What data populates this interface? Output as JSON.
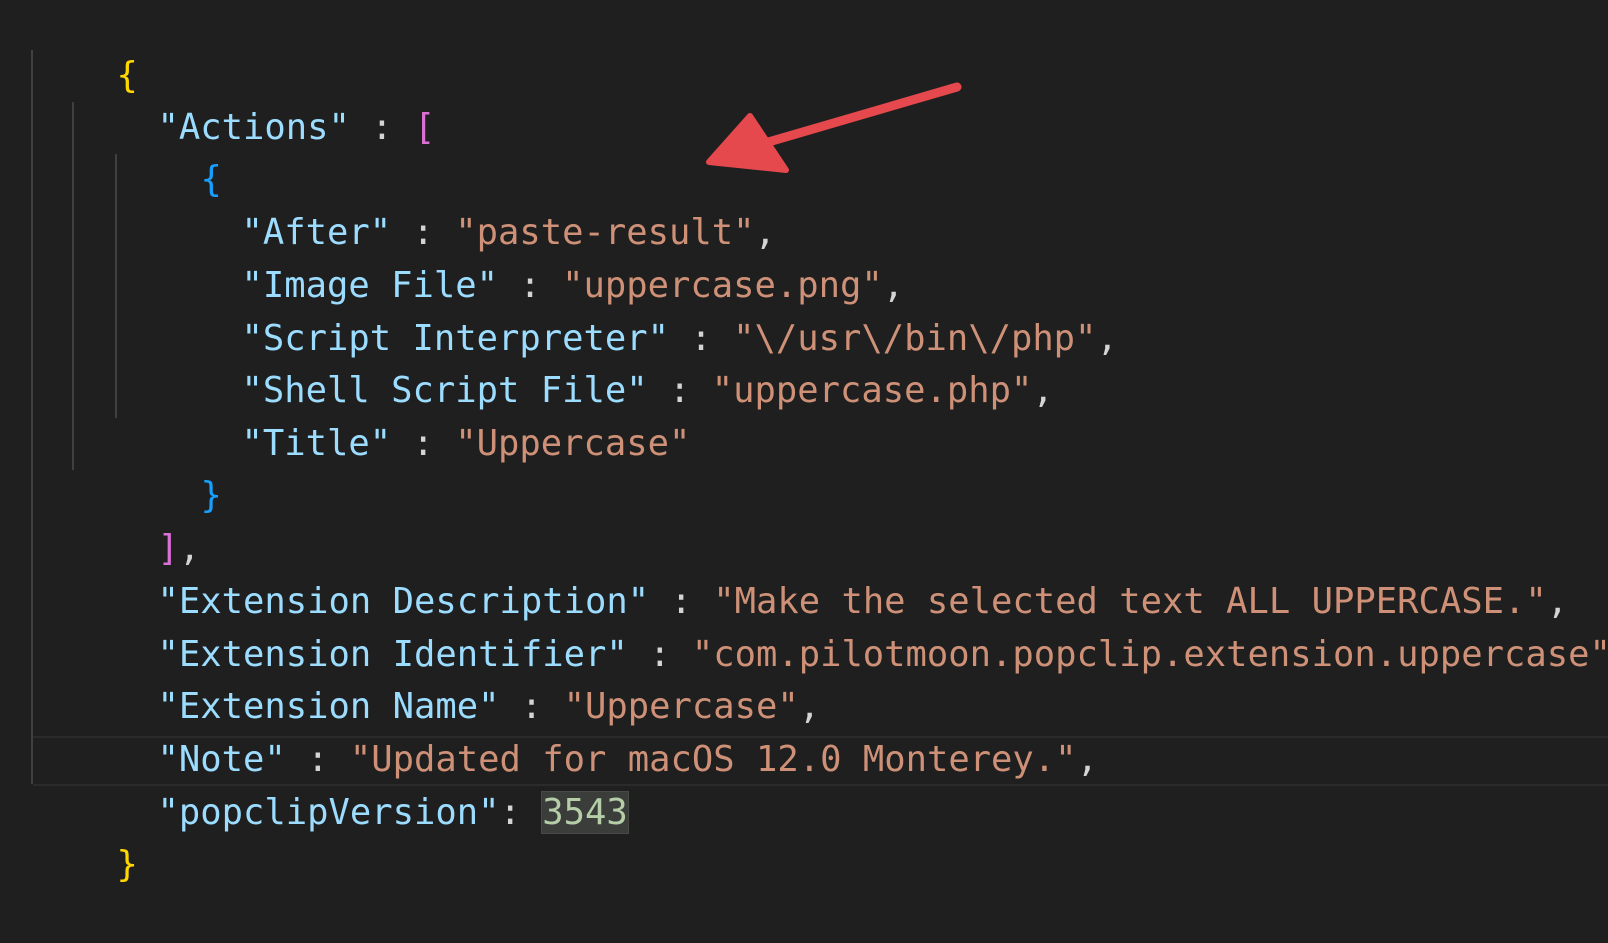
{
  "code": {
    "open_root": "{",
    "actions_key": "\"Actions\"",
    "colon": " : ",
    "open_array": "[",
    "open_obj": "{",
    "after_key": "\"After\"",
    "after_val": "\"paste-result\"",
    "image_key": "\"Image File\"",
    "image_val": "\"uppercase.png\"",
    "interp_key": "\"Script Interpreter\"",
    "interp_val": "\"\\/usr\\/bin\\/php\"",
    "shell_key": "\"Shell Script File\"",
    "shell_val": "\"uppercase.php\"",
    "title_key": "\"Title\"",
    "title_val": "\"Uppercase\"",
    "close_obj": "}",
    "close_array": "]",
    "comma": ",",
    "desc_key": "\"Extension Description\"",
    "desc_val": "\"Make the selected text ALL UPPERCASE.\"",
    "ident_key": "\"Extension Identifier\"",
    "ident_val": "\"com.pilotmoon.popclip.extension.uppercase\"",
    "name_key": "\"Extension Name\"",
    "name_val": "\"Uppercase\"",
    "note_key": "\"Note\"",
    "note_val": "\"Updated for macOS 12.0 Monterey.\"",
    "version_key": "\"popclipVersion\"",
    "version_colon": ": ",
    "version_val": "3543",
    "close_root": "}"
  },
  "colors": {
    "background": "#1f1f1f",
    "key": "#9cdcfe",
    "string": "#ce9178",
    "number": "#b5cea8",
    "bracket_level_1": "#ffd700",
    "bracket_level_2": "#da70d6",
    "bracket_level_3": "#179fff",
    "arrow": "#e5484d"
  },
  "annotation": {
    "icon": "red-arrow-icon"
  }
}
